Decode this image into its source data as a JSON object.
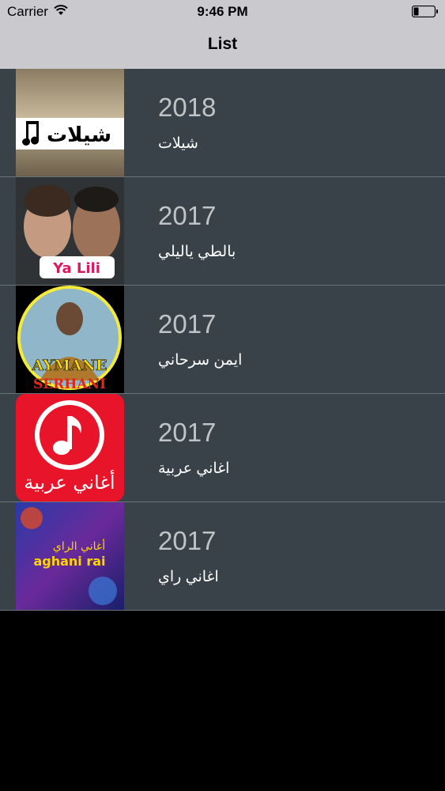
{
  "status_bar": {
    "carrier": "Carrier",
    "time": "9:46 PM",
    "wifi_icon": "wifi-icon",
    "battery_icon": "battery-icon"
  },
  "nav": {
    "title": "List"
  },
  "colors": {
    "nav_background": "#c9c9ce",
    "list_background": "#394248",
    "year_text": "#bfc4c7",
    "title_text": "#ffffff",
    "empty_background": "#000000"
  },
  "items": [
    {
      "year": "2018",
      "title": "شيلات",
      "thumb_text": "شيلات",
      "thumb_icon": "music-note-icon"
    },
    {
      "year": "2017",
      "title": "بالطي ياليلي",
      "thumb_text": "Ya Lili"
    },
    {
      "year": "2017",
      "title": "ايمن سرحاني",
      "thumb_text": "AYMANE",
      "thumb_text2": "SERHANI"
    },
    {
      "year": "2017",
      "title": "اغاني عربية",
      "thumb_text": "أغاني عربية",
      "thumb_icon": "music-note-icon"
    },
    {
      "year": "2017",
      "title": "اغاني راي",
      "thumb_text": "أغاني الراي",
      "thumb_text2": "aghani rai"
    }
  ]
}
